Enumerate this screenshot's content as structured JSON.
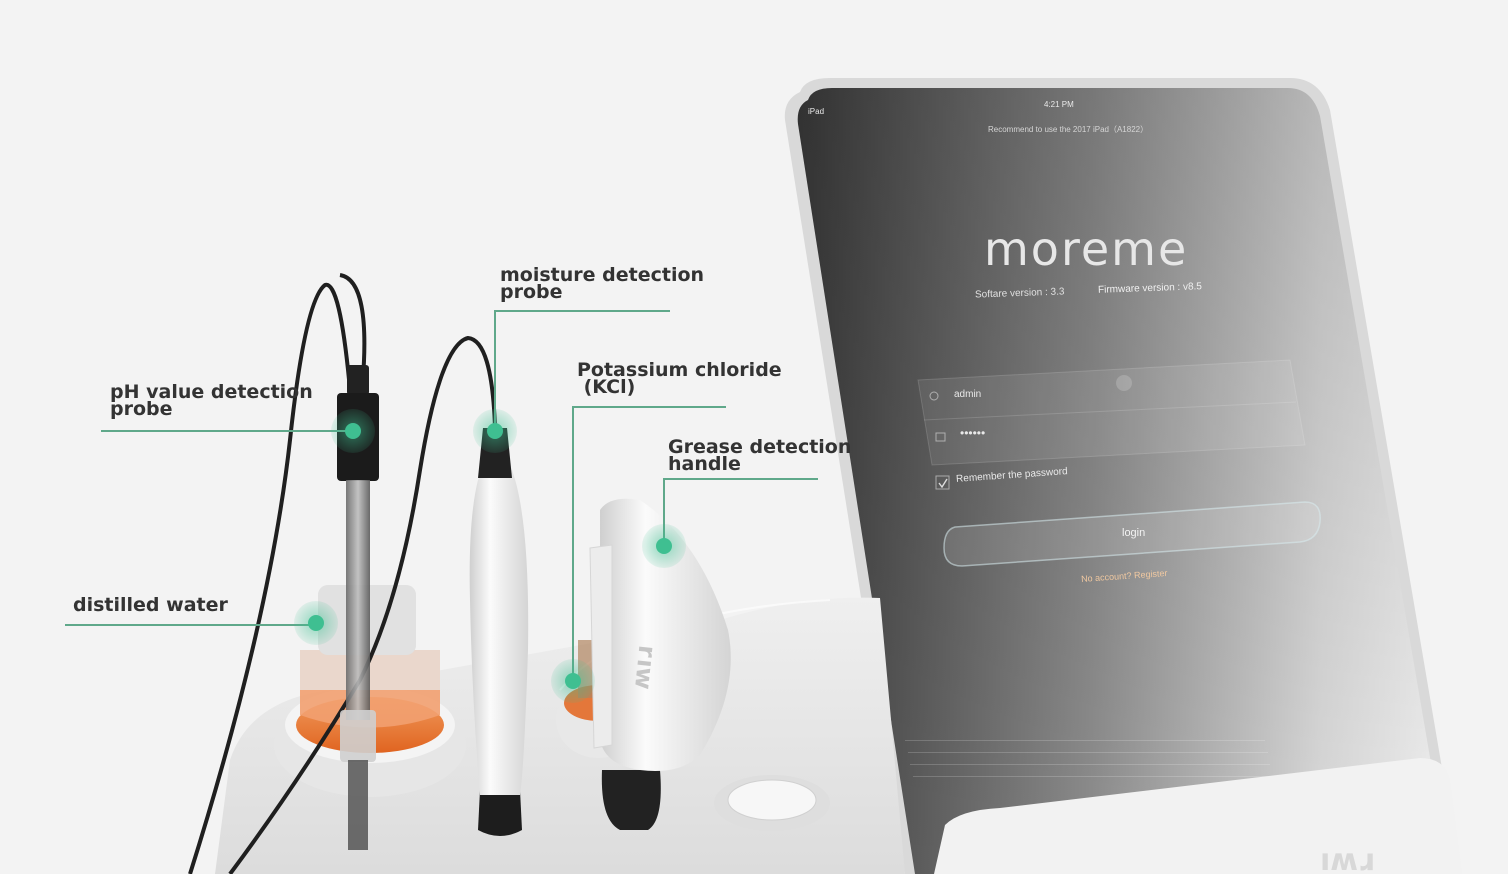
{
  "callouts": {
    "ph_probe": [
      "pH value detection",
      "probe"
    ],
    "moisture_probe": [
      "moisture detection",
      "probe"
    ],
    "kcl": [
      "Potassium chloride",
      " (KCl)"
    ],
    "grease_handle": [
      "Grease detection",
      "handle"
    ],
    "distilled_water": [
      "distilled water"
    ]
  },
  "tablet": {
    "status_device": "iPad",
    "status_time": "4:21 PM",
    "notice": "Recommend to use the 2017 iPad（A1822）",
    "brand": "moreme",
    "software_version": "Softare version : 3.3",
    "firmware_version": "Firmware version : v8.5",
    "username": "admin",
    "password_mask": "••••••",
    "remember_label": "Remember the password",
    "login_label": "login",
    "register_prompt": "No account? Register"
  },
  "colors": {
    "accent_line": "#5fa88a",
    "marker_fill": "#3fbf91",
    "text": "#333333",
    "background": "#f3f3f3",
    "kcl_liquid": "#e4773a"
  }
}
